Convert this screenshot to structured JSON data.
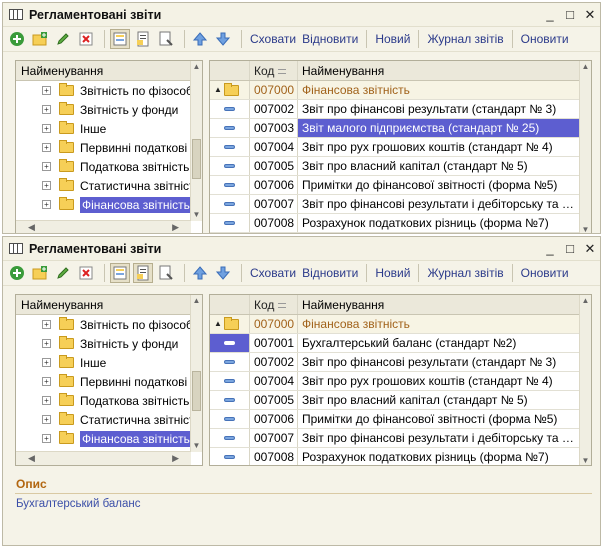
{
  "window": {
    "title": "Регламентовані звіти",
    "controls": [
      "_",
      "□",
      "✕"
    ]
  },
  "toolbar": {
    "icons": [
      "add-icon",
      "add-group-icon",
      "edit-icon",
      "delete-icon",
      "tree-view-icon",
      "report-view-icon",
      "settings-view-icon",
      "move-up-icon",
      "move-down-icon"
    ],
    "buttons": [
      "Сховати",
      "Відновити",
      "Новий",
      "Журнал звітів",
      "Оновити"
    ]
  },
  "tree": {
    "header": "Найменування",
    "items": [
      {
        "label": "Звітність по фізособ"
      },
      {
        "label": "Звітність у фонди"
      },
      {
        "label": "Інше"
      },
      {
        "label": "Первинні податкові д"
      },
      {
        "label": "Податкова звітність"
      },
      {
        "label": "Статистична звітніст"
      },
      {
        "label": "Фінансова звітність"
      }
    ]
  },
  "grid": {
    "headers": {
      "code": "Код",
      "name": "Найменування"
    }
  },
  "panel1": {
    "rows": [
      {
        "code": "007000",
        "name": "Фінансова звітність"
      },
      {
        "code": "007002",
        "name": "Звіт про фінансові результати (стандарт № 3)"
      },
      {
        "code": "007003",
        "name": "Звіт малого підприємства (стандарт № 25)"
      },
      {
        "code": "007004",
        "name": "Звіт про рух грошових коштів (стандарт № 4)"
      },
      {
        "code": "007005",
        "name": "Звіт про власний капітал (стандарт № 5)"
      },
      {
        "code": "007006",
        "name": "Примітки до фінансової звітності (форма №5)"
      },
      {
        "code": "007007",
        "name": "Звіт про фінансові результати і дебіторську та кред..."
      },
      {
        "code": "007008",
        "name": "Розрахунок податкових різниць (форма №7)"
      }
    ]
  },
  "panel2": {
    "rows": [
      {
        "code": "007000",
        "name": "Фінансова звітність"
      },
      {
        "code": "007001",
        "name": "Бухгалтерський баланс (стандарт №2)"
      },
      {
        "code": "007002",
        "name": "Звіт про фінансові результати (стандарт № 3)"
      },
      {
        "code": "007004",
        "name": "Звіт про рух грошових коштів (стандарт № 4)"
      },
      {
        "code": "007005",
        "name": "Звіт про власний капітал (стандарт № 5)"
      },
      {
        "code": "007006",
        "name": "Примітки до фінансової звітності (форма №5)"
      },
      {
        "code": "007007",
        "name": "Звіт про фінансові результати і дебіторську та кред..."
      },
      {
        "code": "007008",
        "name": "Розрахунок податкових різниць (форма №7)"
      }
    ]
  },
  "description": {
    "title": "Опис",
    "text": "Бухгалтерський баланс"
  },
  "colors": {
    "selection": "#5d5ed0",
    "group_text": "#a1621a",
    "link_text": "#2b3a8a",
    "window_bg": "#f5f3e8"
  }
}
